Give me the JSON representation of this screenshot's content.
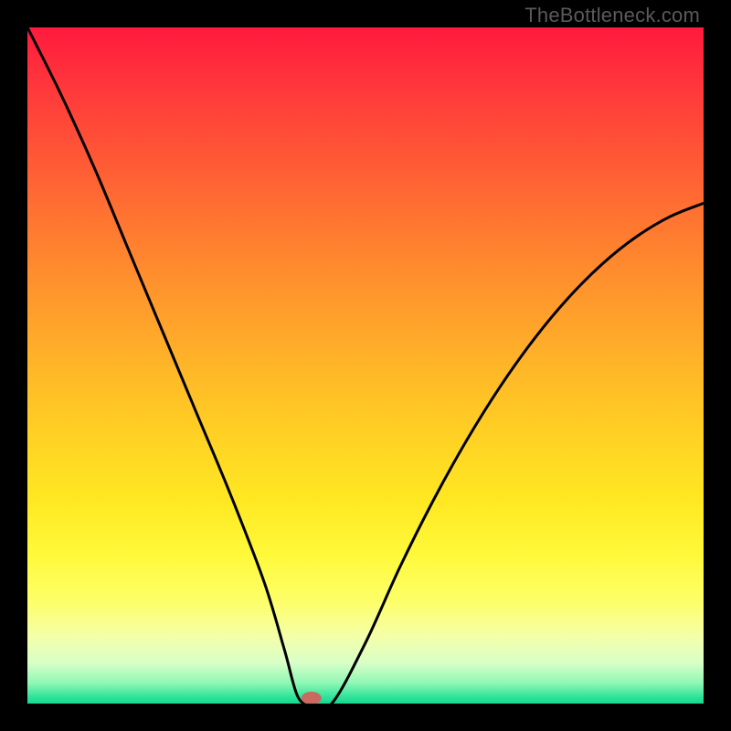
{
  "watermark": "TheBottleneck.com",
  "chart_data": {
    "type": "line",
    "title": "",
    "xlabel": "",
    "ylabel": "",
    "xlim": [
      0,
      100
    ],
    "ylim": [
      0,
      100
    ],
    "background_gradient": {
      "top": "#ff1a3d",
      "middle": "#ffe822",
      "bottom": "#14d88f"
    },
    "marker": {
      "x": 42,
      "y": 0,
      "color": "#c86a5f"
    },
    "series": [
      {
        "name": "bottleneck-curve",
        "x": [
          0,
          5,
          10,
          15,
          20,
          25,
          30,
          35,
          38,
          40,
          42,
          45,
          50,
          55,
          60,
          65,
          70,
          75,
          80,
          85,
          90,
          95,
          100
        ],
        "values": [
          100,
          90,
          79,
          67,
          55,
          43,
          31,
          18,
          8,
          1,
          0,
          0,
          9,
          20,
          30,
          39,
          47,
          54,
          60,
          65,
          69,
          72,
          74
        ]
      }
    ]
  }
}
